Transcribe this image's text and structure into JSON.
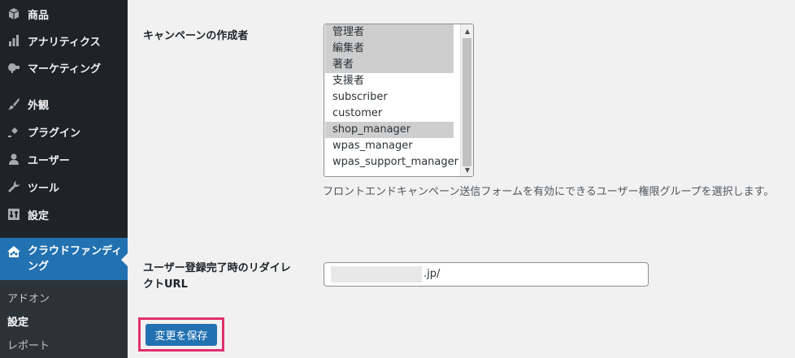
{
  "sidebar": {
    "items": [
      {
        "label": "商品",
        "icon": "cube-icon"
      },
      {
        "label": "アナリティクス",
        "icon": "bar-chart-icon"
      },
      {
        "label": "マーケティング",
        "icon": "megaphone-icon"
      },
      {
        "label": "外観",
        "icon": "paintbrush-icon"
      },
      {
        "label": "プラグイン",
        "icon": "plugin-icon"
      },
      {
        "label": "ユーザー",
        "icon": "user-icon"
      },
      {
        "label": "ツール",
        "icon": "wrench-icon"
      },
      {
        "label": "設定",
        "icon": "settings-icon"
      }
    ],
    "active_item": {
      "label": "クラウドファンディング",
      "icon": "crowdfunding-icon"
    },
    "submenu": [
      "アドオン",
      "設定",
      "レポート"
    ]
  },
  "form": {
    "campaign_author_label": "キャンペーンの作成者",
    "roles": [
      {
        "label": "管理者",
        "selected": true
      },
      {
        "label": "編集者",
        "selected": true
      },
      {
        "label": "著者",
        "selected": true
      },
      {
        "label": "支援者",
        "selected": false
      },
      {
        "label": "subscriber",
        "selected": false
      },
      {
        "label": "customer",
        "selected": false
      },
      {
        "label": "shop_manager",
        "selected": true
      },
      {
        "label": "wpas_manager",
        "selected": false
      },
      {
        "label": "wpas_support_manager",
        "selected": false
      }
    ],
    "roles_help": "フロントエンドキャンペーン送信フォームを有効にできるユーザー権限グループを選択します。",
    "redirect_label_line1": "ユーザー登録完了時のリダイレ",
    "redirect_label_line2": "クトURL",
    "redirect_url_visible": ".jp/",
    "save_label": "変更を保存"
  },
  "colors": {
    "sidebar_bg": "#1d2327",
    "accent": "#2271b1",
    "highlight_border": "#e0306e",
    "selected_option": "#cecece"
  }
}
